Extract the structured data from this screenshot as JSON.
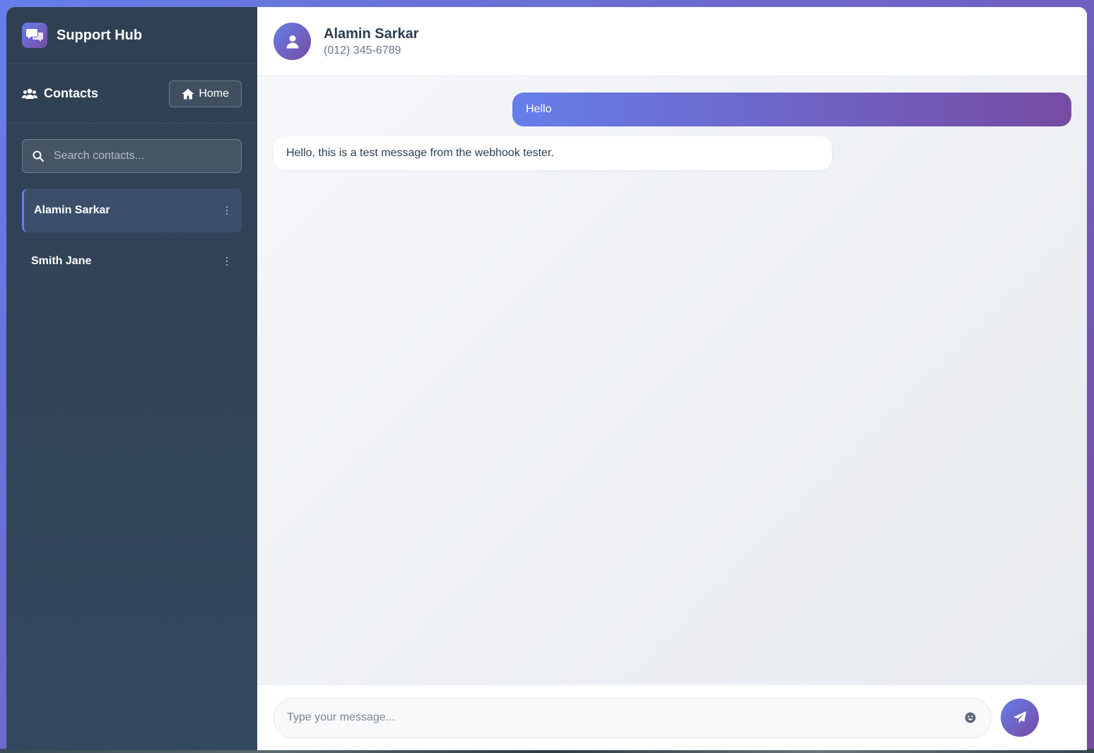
{
  "brand": {
    "title": "Support Hub",
    "icon": "chat-bubbles-icon"
  },
  "contacts": {
    "title": "Contacts",
    "home_label": "Home",
    "search_placeholder": "Search contacts...",
    "items": [
      {
        "name": "Alamin Sarkar",
        "active": true
      },
      {
        "name": "Smith Jane",
        "active": false
      }
    ]
  },
  "chat": {
    "contact_name": "Alamin Sarkar",
    "contact_phone": "(012) 345-6789",
    "messages": [
      {
        "direction": "outgoing",
        "text": "Hello"
      },
      {
        "direction": "incoming",
        "text": "Hello, this is a test message from the webhook tester."
      }
    ],
    "composer_placeholder": "Type your message..."
  },
  "colors": {
    "accent_start": "#667eea",
    "accent_end": "#764ba2",
    "sidebar_bg": "#34495e"
  }
}
